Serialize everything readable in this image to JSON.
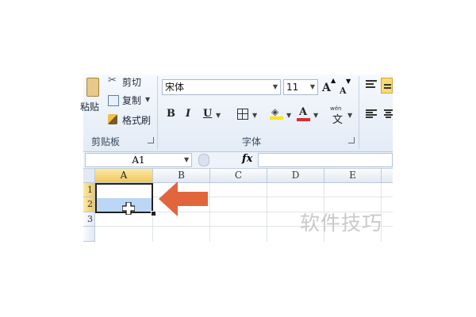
{
  "clipboard": {
    "paste": "粘贴",
    "cut": "剪切",
    "copy": "复制",
    "format_painter": "格式刷",
    "group_label": "剪贴板"
  },
  "font": {
    "name": "宋体",
    "size": "11",
    "bold": "B",
    "italic": "I",
    "underline": "U",
    "grow": "A",
    "shrink": "A",
    "font_color": "A",
    "wen": "wén",
    "wen_char": "文",
    "group_label": "字体"
  },
  "formula_bar": {
    "name_box": "A1",
    "fx": "fx",
    "value": ""
  },
  "grid": {
    "columns": [
      "A",
      "B",
      "C",
      "D",
      "E"
    ],
    "rows": [
      "1",
      "2",
      "3"
    ],
    "selected_column": "A"
  },
  "watermark": "软件技巧",
  "colors": {
    "accent_arrow": "#e1663c",
    "selection_fill": "#bcd7f5",
    "header_selected": "#f2c85a",
    "font_color_red": "#d32f2f",
    "highlight_yellow": "#ffe600"
  }
}
